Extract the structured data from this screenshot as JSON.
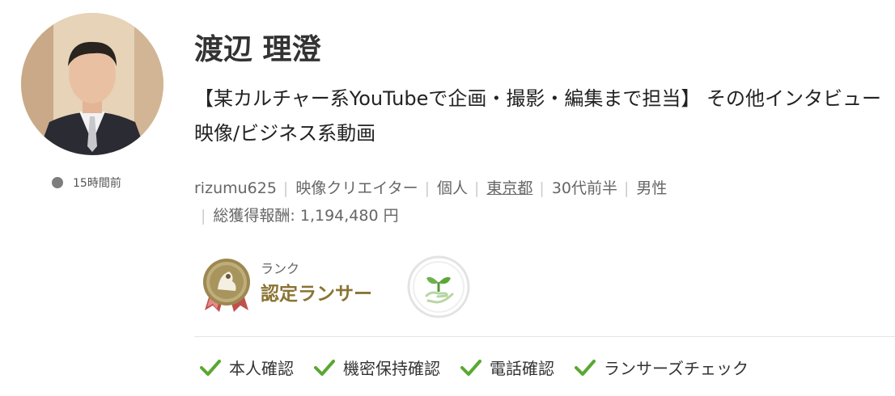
{
  "profile": {
    "name": "渡辺 理澄",
    "headline": "【某カルチャー系YouTubeで企画・撮影・編集まで担当】 その他インタビュー映像/ビジネス系動画",
    "last_active": "15時間前",
    "avatar_icon": "profile-photo"
  },
  "meta": {
    "username": "rizumu625",
    "occupation": "映像クリエイター",
    "entity_type": "個人",
    "location": "東京都",
    "age_range": "30代前半",
    "gender": "男性",
    "total_earnings_label": "総獲得報酬:",
    "total_earnings_value": "1,194,480 円"
  },
  "rank": {
    "label": "ランク",
    "value": "認定ランサー",
    "badge_icon": "certified-badge-icon",
    "plant_icon": "seedling-hand-icon"
  },
  "verifications": [
    {
      "label": "本人確認",
      "icon": "check-icon"
    },
    {
      "label": "機密保持確認",
      "icon": "check-icon"
    },
    {
      "label": "電話確認",
      "icon": "check-icon"
    },
    {
      "label": "ランサーズチェック",
      "icon": "check-icon"
    }
  ],
  "colors": {
    "rank_text": "#8a7434",
    "check_green": "#5aa832",
    "status_dot": "#7d7d7d"
  }
}
